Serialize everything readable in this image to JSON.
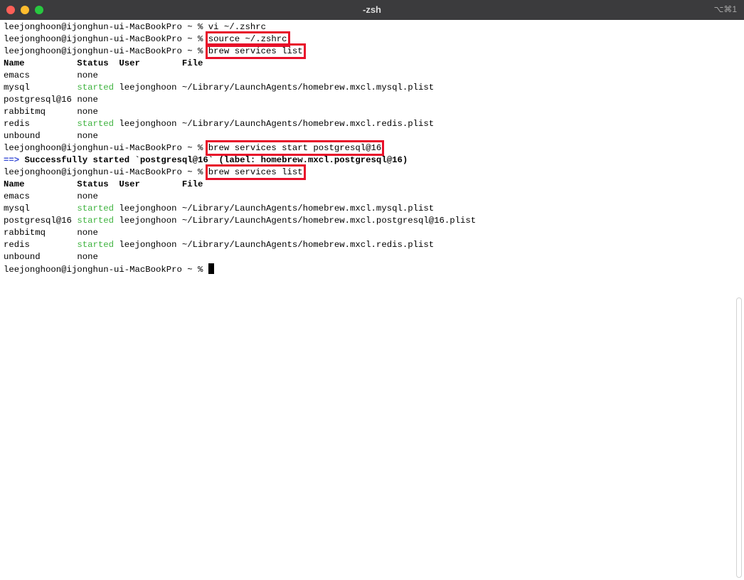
{
  "window": {
    "title": "-zsh",
    "shortcut": "⌥⌘1",
    "colors": {
      "close": "#fe5f57",
      "minimize": "#febc2e",
      "maximize": "#28c840",
      "highlight_box": "#e8102a",
      "started_status": "#3fb33f",
      "arrow": "#3b4fd6"
    }
  },
  "terminal": {
    "prompt": "leejonghoon@ijonghun-ui-MacBookPro ~ % ",
    "commands": {
      "vi": "vi ~/.zshrc",
      "source": "source ~/.zshrc",
      "list1": "brew services list",
      "start": "brew services start postgresql@16",
      "list2": "brew services list"
    },
    "header": "Name          Status  User        File",
    "table1": [
      {
        "name": "emacs         ",
        "status": "none",
        "rest": ""
      },
      {
        "name": "mysql         ",
        "status": "started",
        "rest": " leejonghoon ~/Library/LaunchAgents/homebrew.mxcl.mysql.plist"
      },
      {
        "name": "postgresql@16 ",
        "status": "none",
        "rest": ""
      },
      {
        "name": "rabbitmq      ",
        "status": "none",
        "rest": ""
      },
      {
        "name": "redis         ",
        "status": "started",
        "rest": " leejonghoon ~/Library/LaunchAgents/homebrew.mxcl.redis.plist"
      },
      {
        "name": "unbound       ",
        "status": "none",
        "rest": ""
      }
    ],
    "success_arrow": "==>",
    "success_message": " Successfully started `postgresql@16` (label: homebrew.mxcl.postgresql@16)",
    "table2": [
      {
        "name": "emacs         ",
        "status": "none",
        "rest": ""
      },
      {
        "name": "mysql         ",
        "status": "started",
        "rest": " leejonghoon ~/Library/LaunchAgents/homebrew.mxcl.mysql.plist"
      },
      {
        "name": "postgresql@16 ",
        "status": "started",
        "rest": " leejonghoon ~/Library/LaunchAgents/homebrew.mxcl.postgresql@16.plist"
      },
      {
        "name": "rabbitmq      ",
        "status": "none",
        "rest": ""
      },
      {
        "name": "redis         ",
        "status": "started",
        "rest": " leejonghoon ~/Library/LaunchAgents/homebrew.mxcl.redis.plist"
      },
      {
        "name": "unbound       ",
        "status": "none",
        "rest": ""
      }
    ]
  }
}
